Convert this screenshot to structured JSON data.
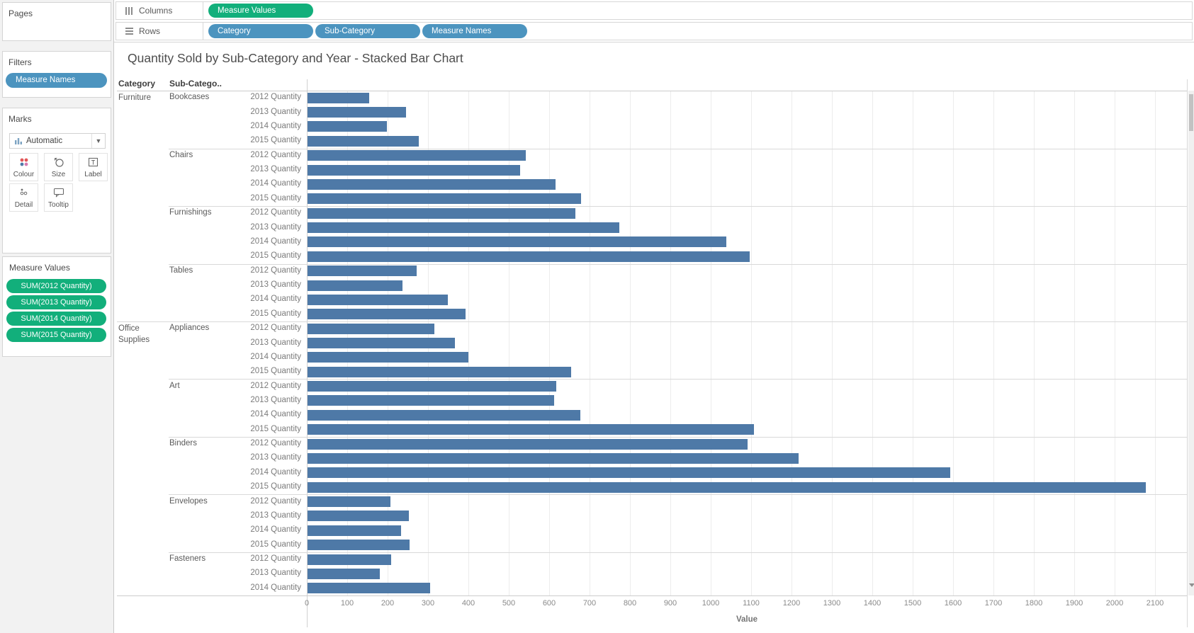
{
  "colors": {
    "bar": "#4E79A7",
    "measure_pill": "#12AF7B",
    "dimension_pill": "#4C94BF",
    "colour_icon_dots": [
      "#e15759",
      "#e15759",
      "#4e79a7",
      "#d67ab1"
    ]
  },
  "sidebar": {
    "pages_label": "Pages",
    "filters_label": "Filters",
    "filters_pills": [
      "Measure Names"
    ],
    "marks_label": "Marks",
    "marks_mode": "Automatic",
    "mark_buttons": [
      {
        "label": "Colour",
        "icon": "colour-icon"
      },
      {
        "label": "Size",
        "icon": "size-icon"
      },
      {
        "label": "Label",
        "icon": "label-icon"
      },
      {
        "label": "Detail",
        "icon": "detail-icon"
      },
      {
        "label": "Tooltip",
        "icon": "tooltip-icon"
      }
    ],
    "measure_values_label": "Measure Values",
    "measure_values_pills": [
      "SUM(2012 Quantity)",
      "SUM(2013 Quantity)",
      "SUM(2014 Quantity)",
      "SUM(2015 Quantity)"
    ]
  },
  "shelves": {
    "columns_label": "Columns",
    "columns_pills": [
      {
        "text": "Measure Values",
        "kind": "measure"
      }
    ],
    "rows_label": "Rows",
    "rows_pills": [
      {
        "text": "Category",
        "kind": "dimension"
      },
      {
        "text": "Sub-Category",
        "kind": "dimension"
      },
      {
        "text": "Measure Names",
        "kind": "dimension"
      }
    ]
  },
  "chart": {
    "title": "Quantity Sold by Sub-Category and Year - Stacked Bar Chart",
    "headers": [
      "Category",
      "Sub-Catego.."
    ]
  },
  "chart_data": {
    "type": "bar",
    "orientation": "horizontal",
    "title": "Quantity Sold by Sub-Category and Year - Stacked Bar Chart",
    "xlabel": "Value",
    "axis": {
      "min": 0,
      "labeled_max": 2100,
      "step": 100,
      "visible_max": 2175,
      "grid": true
    },
    "note": "rows below Fasteners 2014 are scrolled out of view",
    "groups": [
      {
        "category": "Furniture",
        "subcategories": [
          {
            "name": "Bookcases",
            "rows": [
              {
                "label": "2012 Quantity",
                "value": 153
              },
              {
                "label": "2013 Quantity",
                "value": 243
              },
              {
                "label": "2014 Quantity",
                "value": 196
              },
              {
                "label": "2015 Quantity",
                "value": 276
              }
            ]
          },
          {
            "name": "Chairs",
            "rows": [
              {
                "label": "2012 Quantity",
                "value": 540
              },
              {
                "label": "2013 Quantity",
                "value": 527
              },
              {
                "label": "2014 Quantity",
                "value": 614
              },
              {
                "label": "2015 Quantity",
                "value": 678
              }
            ]
          },
          {
            "name": "Furnishings",
            "rows": [
              {
                "label": "2012 Quantity",
                "value": 664
              },
              {
                "label": "2013 Quantity",
                "value": 772
              },
              {
                "label": "2014 Quantity",
                "value": 1036
              },
              {
                "label": "2015 Quantity",
                "value": 1094
              }
            ]
          },
          {
            "name": "Tables",
            "rows": [
              {
                "label": "2012 Quantity",
                "value": 271
              },
              {
                "label": "2013 Quantity",
                "value": 235
              },
              {
                "label": "2014 Quantity",
                "value": 347
              },
              {
                "label": "2015 Quantity",
                "value": 391
              }
            ]
          }
        ]
      },
      {
        "category": "Office Supplies",
        "subcategories": [
          {
            "name": "Appliances",
            "rows": [
              {
                "label": "2012 Quantity",
                "value": 314
              },
              {
                "label": "2013 Quantity",
                "value": 365
              },
              {
                "label": "2014 Quantity",
                "value": 398
              },
              {
                "label": "2015 Quantity",
                "value": 652
              }
            ]
          },
          {
            "name": "Art",
            "rows": [
              {
                "label": "2012 Quantity",
                "value": 615
              },
              {
                "label": "2013 Quantity",
                "value": 610
              },
              {
                "label": "2014 Quantity",
                "value": 676
              },
              {
                "label": "2015 Quantity",
                "value": 1106
              }
            ]
          },
          {
            "name": "Binders",
            "rows": [
              {
                "label": "2012 Quantity",
                "value": 1089
              },
              {
                "label": "2013 Quantity",
                "value": 1215
              },
              {
                "label": "2014 Quantity",
                "value": 1592
              },
              {
                "label": "2015 Quantity",
                "value": 2075
              }
            ]
          },
          {
            "name": "Envelopes",
            "rows": [
              {
                "label": "2012 Quantity",
                "value": 205
              },
              {
                "label": "2013 Quantity",
                "value": 250
              },
              {
                "label": "2014 Quantity",
                "value": 231
              },
              {
                "label": "2015 Quantity",
                "value": 253
              }
            ]
          },
          {
            "name": "Fasteners",
            "rows": [
              {
                "label": "2012 Quantity",
                "value": 207
              },
              {
                "label": "2013 Quantity",
                "value": 179
              },
              {
                "label": "2014 Quantity",
                "value": 303
              }
            ]
          }
        ]
      }
    ]
  }
}
